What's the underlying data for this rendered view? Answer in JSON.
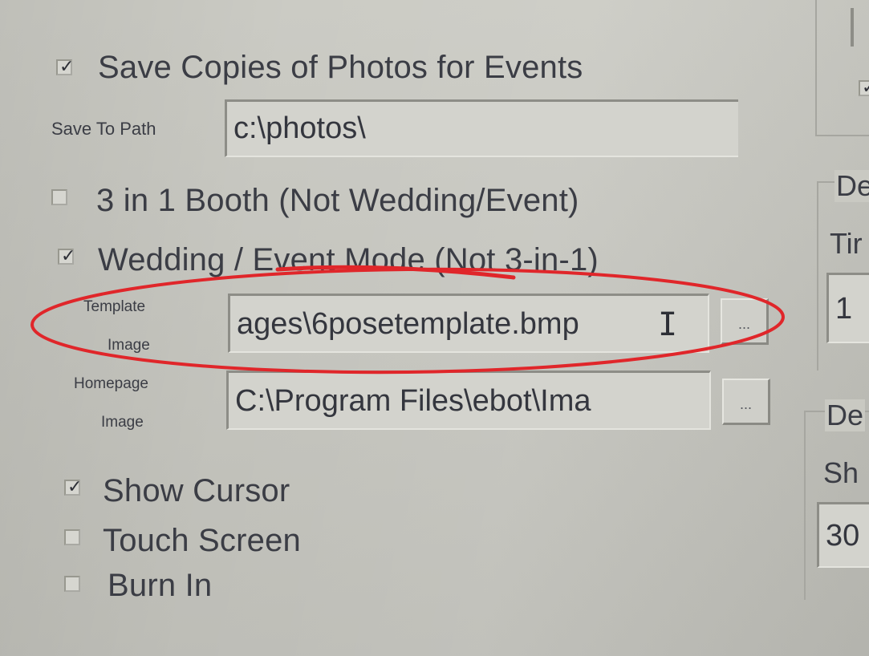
{
  "options": {
    "save_copies": {
      "label": "Save Copies of Photos for Events",
      "checked": true
    },
    "save_to_path": {
      "label": "Save To Path",
      "value": "c:\\photos\\"
    },
    "three_in_one": {
      "label": "3 in 1 Booth (Not Wedding/Event)",
      "checked": false
    },
    "wedding_mode": {
      "label": "Wedding / Event Mode  (Not 3-in-1)",
      "checked": true
    },
    "template_image": {
      "label_line1": "Template",
      "label_line2": "Image",
      "value": "ages\\6posetemplate.bmp",
      "browse_label": "..."
    },
    "homepage_image": {
      "label_line1": "Homepage",
      "label_line2": "Image",
      "value": "C:\\Program Files\\ebot\\Ima",
      "browse_label": "..."
    },
    "show_cursor": {
      "label": "Show Cursor",
      "checked": true
    },
    "touch_screen": {
      "label": "Touch Screen",
      "checked": false
    },
    "burn_in": {
      "label": "Burn In",
      "checked": false
    }
  },
  "right_panel": {
    "group1": {
      "title": "De",
      "label": "Tir",
      "value": "1"
    },
    "group2": {
      "title": "De",
      "label": "Sh",
      "value": "30"
    }
  },
  "annotation": {
    "color": "#e0262a"
  },
  "glyphs": {
    "checkmark": "✓"
  }
}
